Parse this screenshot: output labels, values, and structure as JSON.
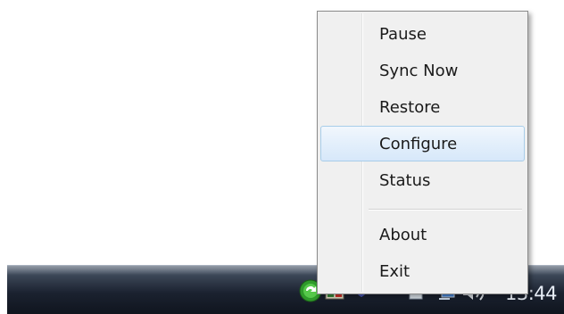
{
  "context_menu": {
    "items": [
      {
        "label": "Pause"
      },
      {
        "label": "Sync Now"
      },
      {
        "label": "Restore"
      },
      {
        "label": "Configure",
        "highlighted": true
      },
      {
        "label": "Status"
      },
      {
        "label": "About"
      },
      {
        "label": "Exit"
      }
    ],
    "highlight_color": "#d7e8fa"
  },
  "taskbar": {
    "clock": "13:44",
    "tray_icons": [
      "sync-app-icon",
      "app-window-icon",
      "shield-icon",
      "document-icon",
      "network-icon",
      "volume-icon"
    ]
  }
}
